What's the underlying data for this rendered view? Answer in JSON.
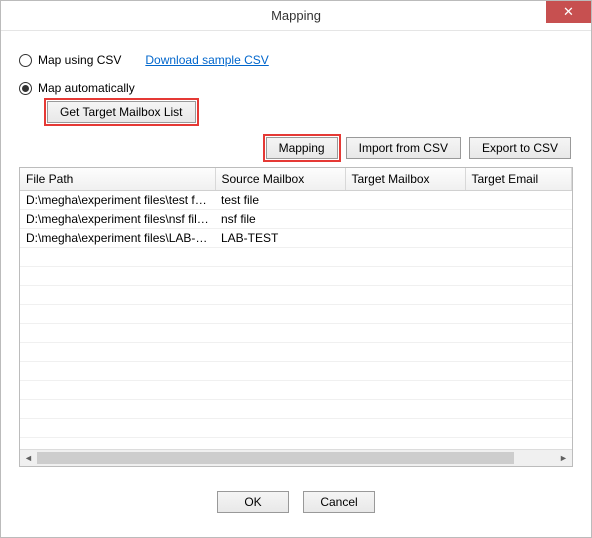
{
  "window": {
    "title": "Mapping",
    "close": "✕"
  },
  "options": {
    "map_csv_label": "Map using CSV",
    "download_link": "Download sample CSV",
    "map_auto_label": "Map automatically",
    "get_target_btn": "Get Target Mailbox List"
  },
  "toolbar": {
    "mapping": "Mapping",
    "import_csv": "Import from CSV",
    "export_csv": "Export to CSV"
  },
  "table": {
    "columns": [
      "File Path",
      "Source Mailbox",
      "Target Mailbox",
      "Target Email"
    ],
    "rows": [
      {
        "file_path": "D:\\megha\\experiment files\\test file.nsf",
        "source": "test file",
        "target_mailbox": "",
        "target_email": ""
      },
      {
        "file_path": "D:\\megha\\experiment files\\nsf file.nsf",
        "source": "nsf file",
        "target_mailbox": "",
        "target_email": ""
      },
      {
        "file_path": "D:\\megha\\experiment files\\LAB-TEST...",
        "source": "LAB-TEST",
        "target_mailbox": "",
        "target_email": ""
      }
    ]
  },
  "footer": {
    "ok": "OK",
    "cancel": "Cancel"
  },
  "scroll": {
    "left": "◄",
    "right": "►"
  }
}
